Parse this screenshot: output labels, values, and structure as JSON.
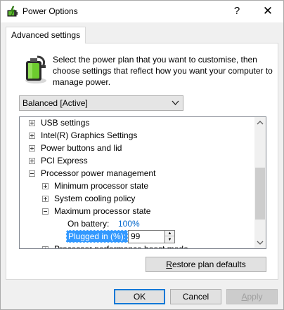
{
  "window": {
    "title": "Power Options",
    "help_glyph": "?",
    "close_glyph": "✕",
    "icon": "power-options-icon"
  },
  "tab": {
    "label": "Advanced settings"
  },
  "description": "Select the power plan that you want to customise, then choose settings that reflect how you want your computer to manage power.",
  "plan_select": {
    "value": "Balanced [Active]",
    "icon": "chevron-down-icon"
  },
  "tree": {
    "items": [
      {
        "label": "USB settings",
        "expander": "plus"
      },
      {
        "label": "Intel(R) Graphics Settings",
        "expander": "plus"
      },
      {
        "label": "Power buttons and lid",
        "expander": "plus"
      },
      {
        "label": "PCI Express",
        "expander": "plus"
      },
      {
        "label": "Processor power management",
        "expander": "minus"
      },
      {
        "label": "Minimum processor state",
        "expander": "plus"
      },
      {
        "label": "System cooling policy",
        "expander": "plus"
      },
      {
        "label": "Maximum processor state",
        "expander": "minus"
      },
      {
        "label": "On battery:",
        "value": "100%"
      },
      {
        "label": "Plugged in (%):",
        "value": "99"
      },
      {
        "label": "Processor performance boost mode",
        "expander": "plus"
      }
    ]
  },
  "restore_button": {
    "label": "Restore plan defaults",
    "accel": "R"
  },
  "footer": {
    "ok": "OK",
    "cancel": "Cancel",
    "apply": "Apply",
    "apply_accel": "A"
  },
  "colors": {
    "selection": "#3399ff",
    "value_blue": "#0066cc",
    "ok_border": "#0078d7"
  }
}
